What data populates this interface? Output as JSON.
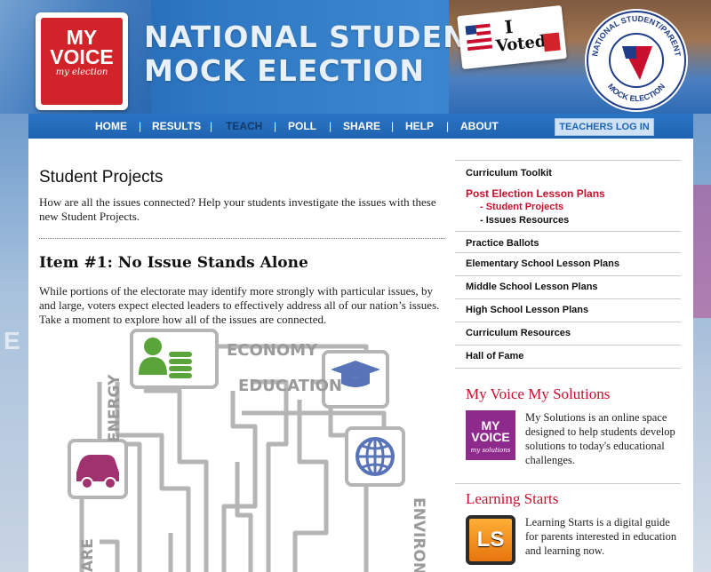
{
  "header": {
    "logo_line1": "MY",
    "logo_line2": "VOICE",
    "logo_line3": "my election",
    "title_line1": "NATIONAL STUDENT",
    "title_line2": "MOCK ELECTION",
    "sticker_line1": "I",
    "sticker_line2": "Voted",
    "seal_top": "NATIONAL STUDENT/PARENT",
    "seal_bottom": "MOCK ELECTION"
  },
  "nav": {
    "items": [
      "HOME",
      "RESULTS",
      "TEACH",
      "POLL",
      "SHARE",
      "HELP",
      "ABOUT"
    ],
    "active": "TEACH",
    "login": "TEACHERS LOG IN"
  },
  "main": {
    "title": "Student Projects",
    "intro": "How are all the issues connected? Help your students investigate the issues with these new Student Projects.",
    "item_title": "Item #1: No Issue Stands Alone",
    "item_text": "While portions of the electorate may identify more strongly with particular issues, by and large, voters expect elected leaders to effectively address all of our nation’s issues. Take a moment to explore how all of the issues are connected.",
    "graphic_labels": {
      "economy": "ECONOMY",
      "education": "EDUCATION",
      "energy": "ENERGY",
      "environ": "ENVIRON",
      "care": "ARE"
    }
  },
  "sidebar": {
    "curriculum_toolkit": "Curriculum Toolkit",
    "post_election": "Post Election Lesson Plans",
    "sub_student_projects": "- Student Projects",
    "sub_issues_resources": "- Issues Resources",
    "practice_ballots": "Practice Ballots",
    "elementary": "Elementary School Lesson Plans",
    "middle": "Middle School Lesson Plans",
    "high": "High School Lesson Plans",
    "resources": "Curriculum Resources",
    "hall_of_fame": "Hall of Fame",
    "promo1_title": "My Voice My Solutions",
    "promo1_img_line1": "MY",
    "promo1_img_line2": "VOICE",
    "promo1_img_line3": "my solutions",
    "promo1_text": "My Solutions is an online space designed to help students develop solutions to today's educational challenges.",
    "promo2_title": "Learning Starts",
    "promo2_img": "LS",
    "promo2_text": "Learning Starts is a digital guide for parents interested in education and learning now."
  },
  "colors": {
    "nav_blue": "#1f64b1",
    "accent_red": "#c8102e",
    "logo_red": "#d2232a",
    "promo_purple": "#8e2a8b"
  }
}
